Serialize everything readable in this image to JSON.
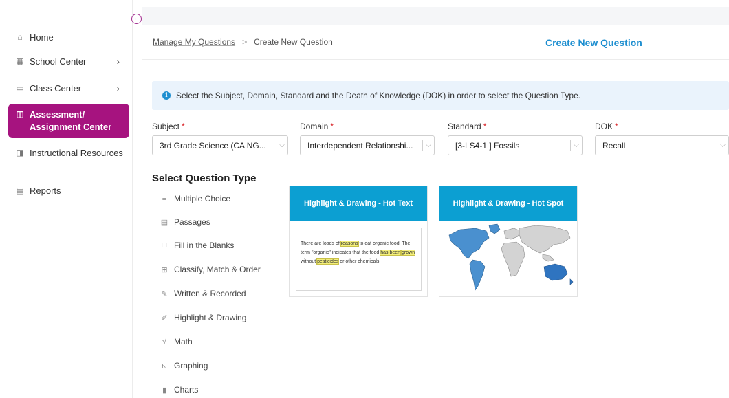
{
  "sidebar": {
    "items": [
      {
        "label": "Home",
        "icon": "home-icon"
      },
      {
        "label": "School Center",
        "icon": "building-icon",
        "chevron": "›"
      },
      {
        "label": "Class Center",
        "icon": "monitor-icon",
        "chevron": "›"
      },
      {
        "label": "Assessment/ Assignment Center",
        "icon": "book-icon",
        "active": true
      },
      {
        "label": "Instructional Resources",
        "icon": "book-open-icon"
      },
      {
        "label": "Reports",
        "icon": "document-icon"
      }
    ]
  },
  "header": {
    "breadcrumb_root": "Manage My Questions",
    "breadcrumb_sep": ">",
    "breadcrumb_current": "Create New Question",
    "title": "Create New Question"
  },
  "info": {
    "text": "Select the Subject, Domain, Standard and the Death of Knowledge (DOK) in order to select the Question Type."
  },
  "form": {
    "subject": {
      "label": "Subject",
      "value": "3rd Grade Science (CA NG..."
    },
    "domain": {
      "label": "Domain",
      "value": "Interdependent Relationshi..."
    },
    "standard": {
      "label": "Standard",
      "value": "[3-LS4-1 ] Fossils"
    },
    "dok": {
      "label": "DOK",
      "value": "Recall"
    },
    "required_mark": "*"
  },
  "question_types": {
    "heading": "Select Question Type",
    "items": [
      {
        "label": "Multiple Choice",
        "icon": "list-icon"
      },
      {
        "label": "Passages",
        "icon": "passage-icon"
      },
      {
        "label": "Fill in the Blanks",
        "icon": "blank-icon"
      },
      {
        "label": "Classify, Match & Order",
        "icon": "grid-icon"
      },
      {
        "label": "Written & Recorded",
        "icon": "pencil-icon"
      },
      {
        "label": "Highlight & Drawing",
        "icon": "highlight-icon"
      },
      {
        "label": "Math",
        "icon": "sqrt-icon"
      },
      {
        "label": "Graphing",
        "icon": "graph-icon"
      },
      {
        "label": "Charts",
        "icon": "bar-chart-icon"
      }
    ]
  },
  "cards": [
    {
      "title": "Highlight & Drawing - Hot Text",
      "sample": {
        "t1": "There are loads of ",
        "h1": "reasons",
        "t2": " to eat organic food. The term \"organic\" indicates that the food ",
        "h2": "has been",
        "t3": " ",
        "h3": "grown",
        "t4": " without ",
        "h4": "pesticides",
        "t5": " or other chemicals."
      }
    },
    {
      "title": "Highlight & Drawing - Hot Spot"
    }
  ],
  "colors": {
    "accent": "#a6137f",
    "brand_blue": "#1f8fd0",
    "card_header": "#0c9fd2",
    "highlight": "#f5f07a"
  }
}
